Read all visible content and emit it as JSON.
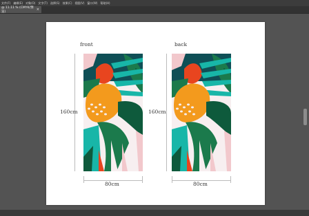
{
  "menu": {
    "items": [
      "文件(F)",
      "编辑(E)",
      "对象(O)",
      "文字(T)",
      "选择(S)",
      "效果(C)",
      "视图(V)",
      "窗口(W)",
      "帮助(H)"
    ]
  },
  "tab": {
    "title": "@ 11.11 % (CMYK/预览)",
    "close": "×"
  },
  "artboard": {
    "front_label": "front",
    "back_label": "back",
    "height_label": "160cm",
    "width_label": "80cm"
  },
  "palette": {
    "teal_dark": "#0f4f56",
    "green": "#1b7a4c",
    "green_dark": "#0e5a3c",
    "orange": "#f39a1d",
    "red": "#e8451f",
    "pink": "#f2c8cc",
    "cyan": "#18b6a8",
    "light": "#f7eff0"
  }
}
